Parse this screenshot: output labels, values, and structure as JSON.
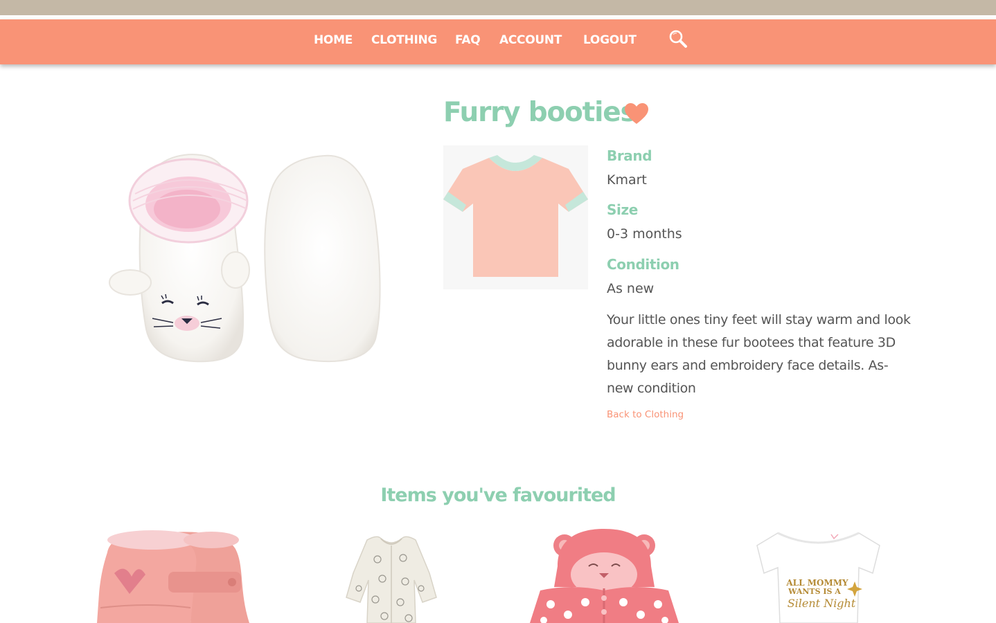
{
  "nav": {
    "items": [
      {
        "label": "HOME"
      },
      {
        "label": "CLOTHING"
      },
      {
        "label": "FAQ"
      },
      {
        "label": "ACCOUNT"
      },
      {
        "label": "LOGOUT"
      }
    ],
    "search_icon": "search-icon"
  },
  "colors": {
    "nav_bg": "#f99376",
    "top_strip": "#c4b8a6",
    "accent_green": "#8dcfb0",
    "accent_coral": "#f99376",
    "text": "#555555"
  },
  "product": {
    "title": "Furry booties",
    "favourite_icon": "heart-icon",
    "thumbnail_icon": "tshirt-icon",
    "brand_label": "Brand",
    "brand_value": "Kmart",
    "size_label": "Size",
    "size_value": "0-3 months",
    "condition_label": "Condition",
    "condition_value": "As new",
    "description": "Your little ones tiny feet will stay warm and look adorable in these fur bootees that feature 3D bunny ears and embroidery face details. As-new condition",
    "back_link": "Back to Clothing"
  },
  "favourites": {
    "title": "Items you've favourited",
    "items": [
      {
        "name": "pink-boots-image"
      },
      {
        "name": "printed-romper-image"
      },
      {
        "name": "pink-hooded-jacket-image"
      },
      {
        "name": "white-onesie-image",
        "print_lines": [
          "ALL MOMMY",
          "WANTS IS A",
          "Silent Night"
        ]
      }
    ]
  }
}
